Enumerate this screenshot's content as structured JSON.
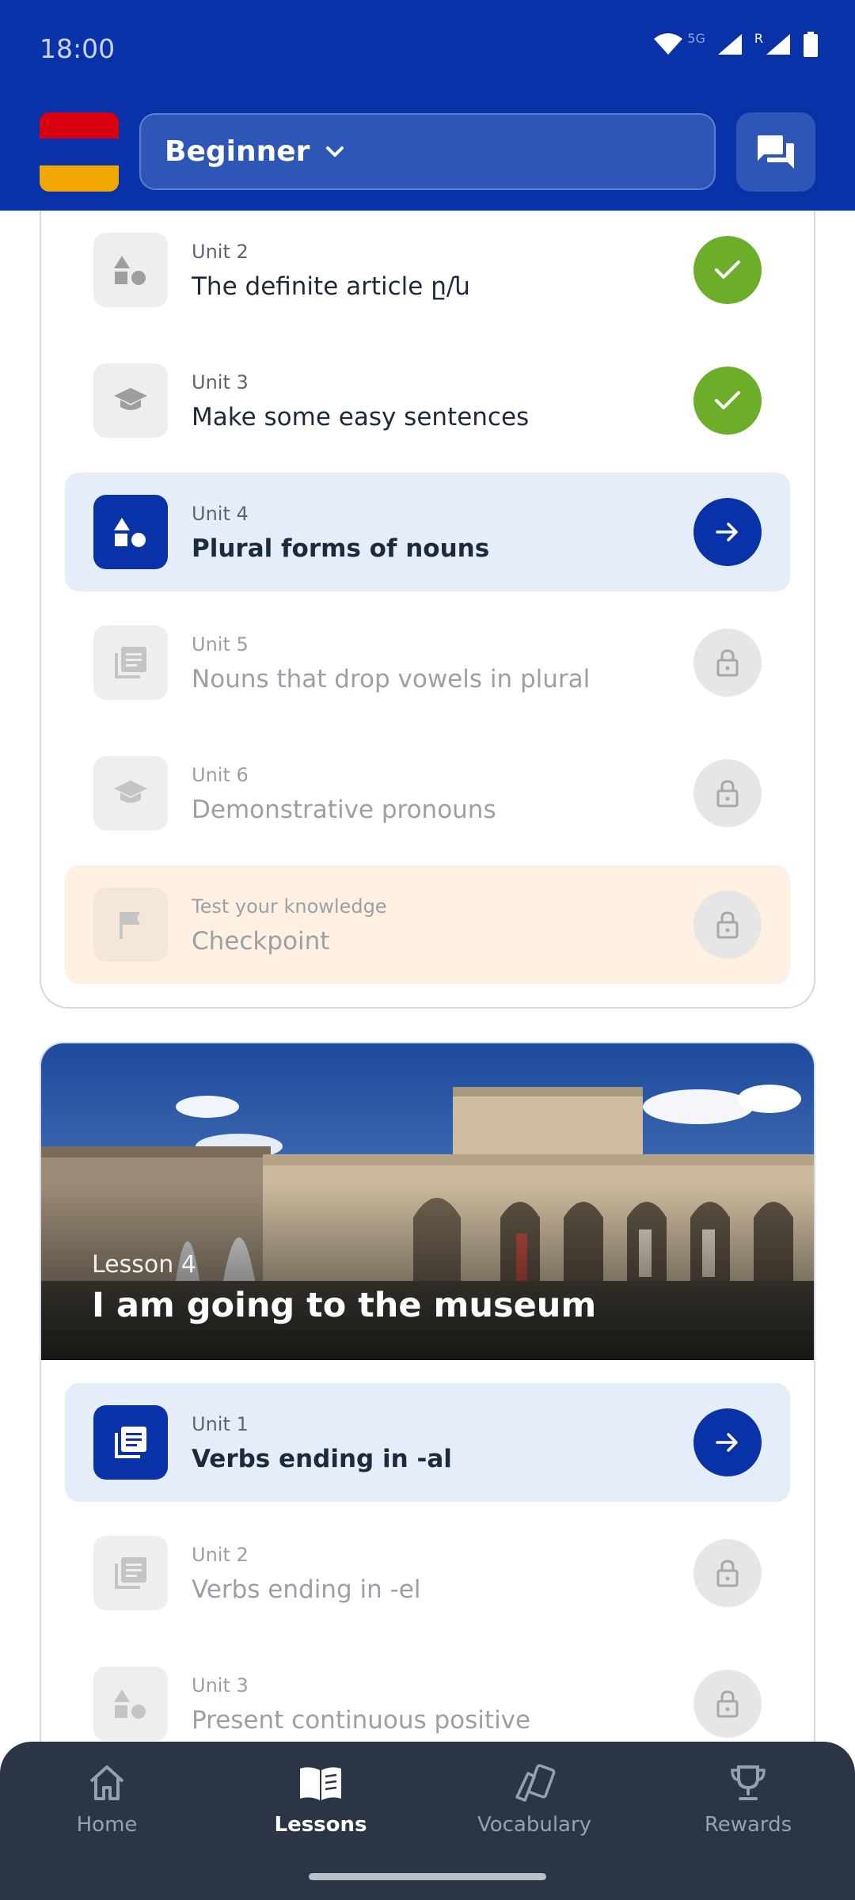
{
  "status_bar": {
    "time": "18:00",
    "network": "5G",
    "roaming": "R"
  },
  "header": {
    "level": "Beginner",
    "flag": "Armenia"
  },
  "lesson3_units": [
    {
      "sub": "Unit 2",
      "title": "The definite article ը/ն",
      "state": "done",
      "icon": "shapes-icon"
    },
    {
      "sub": "Unit 3",
      "title": "Make some easy sentences",
      "state": "done",
      "icon": "graduation-cap-icon"
    },
    {
      "sub": "Unit 4",
      "title": "Plural forms of nouns",
      "state": "active",
      "icon": "shapes-icon"
    },
    {
      "sub": "Unit 5",
      "title": "Nouns that drop vowels in plural",
      "state": "locked",
      "icon": "document-icon"
    },
    {
      "sub": "Unit 6",
      "title": "Demonstrative pronouns",
      "state": "locked",
      "icon": "graduation-cap-icon"
    },
    {
      "sub": "Test your knowledge",
      "title": "Checkpoint",
      "state": "locked",
      "icon": "flag-icon"
    }
  ],
  "lesson4": {
    "label": "Lesson 4",
    "title": "I am going to the museum",
    "units": [
      {
        "sub": "Unit 1",
        "title": "Verbs ending in -al",
        "state": "active",
        "icon": "document-icon"
      },
      {
        "sub": "Unit 2",
        "title": "Verbs ending in -el",
        "state": "locked",
        "icon": "document-icon"
      },
      {
        "sub": "Unit 3",
        "title": "Present continuous positive",
        "state": "locked",
        "icon": "shapes-icon"
      }
    ]
  },
  "nav": [
    {
      "label": "Home",
      "active": false
    },
    {
      "label": "Lessons",
      "active": true
    },
    {
      "label": "Vocabulary",
      "active": false
    },
    {
      "label": "Rewards",
      "active": false
    }
  ],
  "colors": {
    "primary": "#0a32a8",
    "done": "#6cae2a",
    "active_row": "#e5edfb",
    "checkpoint_row": "#fff0e2",
    "nav_bg": "#2b3545"
  }
}
